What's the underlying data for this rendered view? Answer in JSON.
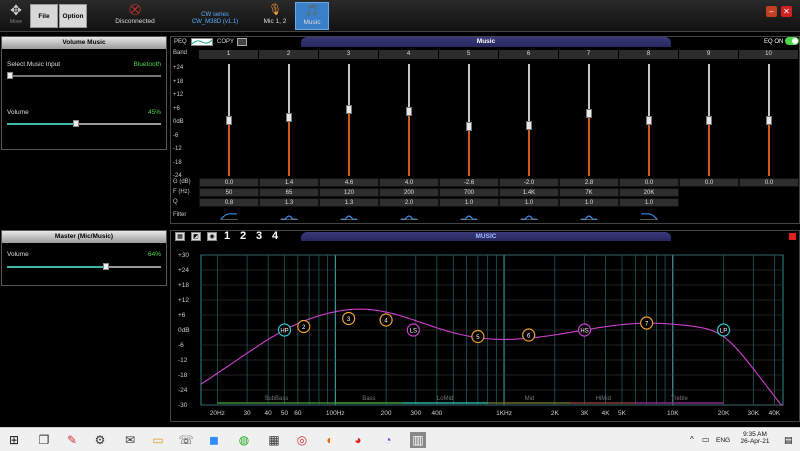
{
  "toolbar": {
    "move_label": "Move",
    "file_label": "File",
    "option_label": "Option",
    "device_status": "Disconnected",
    "device_series": "CW series",
    "device_model": "CW_M38D (v1.1)",
    "mic_label": "Mic 1, 2",
    "music_label": "Music"
  },
  "volume_music": {
    "title": "Volume Music",
    "input_label": "Select Music Input",
    "input_value": "Bluetooth",
    "volume_label": "Volume",
    "volume_value": "45%",
    "volume_fraction": 0.45
  },
  "master": {
    "title": "Master (Mic/Music)",
    "volume_label": "Volume",
    "volume_value": "64%",
    "volume_fraction": 0.64
  },
  "peq": {
    "tab_peq": "PEQ",
    "tab_copy": "COPY",
    "title": "Music",
    "eq_label": "EQ ON",
    "band_label": "Band",
    "scale": [
      "+24",
      "+18",
      "+12",
      "+6",
      "0dB",
      "-6",
      "-12",
      "-18",
      "-24"
    ],
    "row_gain_label": "G (dB)",
    "row_freq_label": "F (Hz)",
    "row_q_label": "Q",
    "row_filter_label": "Filter",
    "bands": [
      {
        "num": "1",
        "gain": "0.0",
        "freq": "50",
        "q": "0.8",
        "gain_db": 0,
        "filter": "hp"
      },
      {
        "num": "2",
        "gain": "1.4",
        "freq": "65",
        "q": "1.3",
        "gain_db": 1.4,
        "filter": "peak"
      },
      {
        "num": "3",
        "gain": "4.6",
        "freq": "120",
        "q": "1.3",
        "gain_db": 4.6,
        "filter": "peak"
      },
      {
        "num": "4",
        "gain": "4.0",
        "freq": "200",
        "q": "2.0",
        "gain_db": 4.0,
        "filter": "peak"
      },
      {
        "num": "5",
        "gain": "-2.6",
        "freq": "700",
        "q": "1.0",
        "gain_db": -2.6,
        "filter": "peak"
      },
      {
        "num": "6",
        "gain": "-2.0",
        "freq": "1.4K",
        "q": "1.0",
        "gain_db": -2.0,
        "filter": "peak"
      },
      {
        "num": "7",
        "gain": "2.8",
        "freq": "7K",
        "q": "1.0",
        "gain_db": 2.8,
        "filter": "peak"
      },
      {
        "num": "8",
        "gain": "0.0",
        "freq": "20K",
        "q": "1.0",
        "gain_db": 0,
        "filter": "lp"
      },
      {
        "num": "9",
        "gain": "0.0",
        "freq": "",
        "q": "",
        "gain_db": 0,
        "filter": ""
      },
      {
        "num": "10",
        "gain": "0.0",
        "freq": "",
        "q": "",
        "gain_db": 0,
        "filter": ""
      }
    ]
  },
  "graph": {
    "icon_labels": [
      "1",
      "2",
      "3",
      "4"
    ],
    "title": "MUSIC",
    "y_ticks": [
      "+30",
      "+24",
      "+18",
      "+12",
      "+6",
      "0dB",
      "-6",
      "-12",
      "-18",
      "-24",
      "-30"
    ],
    "x_ticks": [
      "20Hz",
      "30",
      "40",
      "50",
      "60",
      "100Hz",
      "200",
      "300",
      "400",
      "1KHz",
      "2K",
      "3K",
      "4K",
      "5K",
      "10K",
      "20K",
      "30K",
      "40K"
    ],
    "regions": [
      "SubBass",
      "Bass",
      "LoMid",
      "Mid",
      "HiMid",
      "Treble"
    ],
    "markers": [
      {
        "label": "HP",
        "freq": 50,
        "gain": 0,
        "color": "#33c8d8"
      },
      {
        "label": "2",
        "freq": 65,
        "gain": 1.4,
        "color": "#f0a030"
      },
      {
        "label": "3",
        "freq": 120,
        "gain": 4.6,
        "color": "#f0a030"
      },
      {
        "label": "4",
        "freq": 200,
        "gain": 4.0,
        "color": "#f0a030"
      },
      {
        "label": "LS",
        "freq": 290,
        "gain": 0,
        "color": "#d040d0"
      },
      {
        "label": "5",
        "freq": 700,
        "gain": -2.6,
        "color": "#f0a030"
      },
      {
        "label": "6",
        "freq": 1400,
        "gain": -2.0,
        "color": "#f0a030"
      },
      {
        "label": "HS",
        "freq": 3000,
        "gain": 0,
        "color": "#d040d0"
      },
      {
        "label": "7",
        "freq": 7000,
        "gain": 2.8,
        "color": "#f0a030"
      },
      {
        "label": "LP",
        "freq": 20000,
        "gain": 0,
        "color": "#33c8d8"
      }
    ]
  },
  "taskbar": {
    "lang": "ENG",
    "time": "9:35 AM",
    "date": "26-Apr-21"
  }
}
